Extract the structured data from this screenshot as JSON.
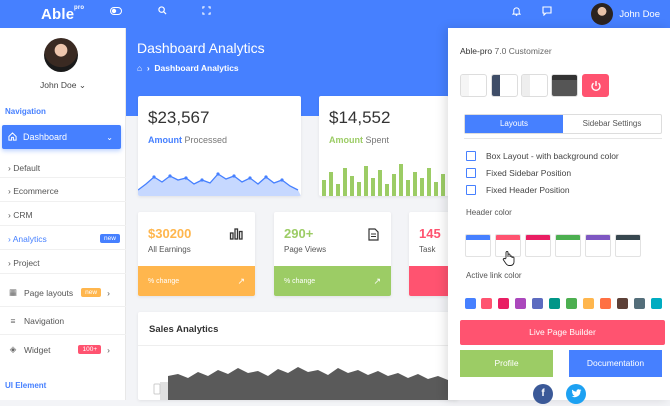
{
  "app": {
    "logo": "Able",
    "logo_sup": "pro"
  },
  "topbar": {
    "user_name": "John Doe"
  },
  "sidebar": {
    "user_name": "John Doe",
    "caption_navigation": "Navigation",
    "active_item": "Dashboard",
    "sub_items": [
      "Default",
      "Ecommerce",
      "CRM",
      "Analytics",
      "Project"
    ],
    "analytics_badge": "new",
    "page_layouts": "Page layouts",
    "page_layouts_badge": "new",
    "navigation": "Navigation",
    "widget": "Widget",
    "widget_badge": "100+",
    "caption_ui": "UI Element"
  },
  "header": {
    "title": "Dashboard Analytics",
    "breadcrumb": "Dashboard Analytics"
  },
  "cards": {
    "processed": {
      "value": "$23,567",
      "label_bold": "Amount",
      "label": "Processed",
      "color": "#4680ff"
    },
    "spent": {
      "value": "$14,552",
      "label_bold": "Amount",
      "label": "Spent",
      "color": "#9ccc65"
    }
  },
  "stats": [
    {
      "value": "$30200",
      "label": "All Earnings",
      "foot": "% change",
      "color": "#ffb64d",
      "icon": "bar-chart-icon"
    },
    {
      "value": "290+",
      "label": "Page Views",
      "foot": "% change",
      "color": "#9ccc65",
      "icon": "document-icon"
    },
    {
      "value": "145",
      "label": "Task",
      "foot": "",
      "color": "#ff5370",
      "icon": "task-icon"
    }
  ],
  "sales": {
    "title": "Sales Analytics"
  },
  "customizer": {
    "title": "Able-pro",
    "version": "7.0 Customizer",
    "tabs": [
      "Layouts",
      "Sidebar Settings"
    ],
    "options": [
      "Box Layout - with background color",
      "Fixed Sidebar Position",
      "Fixed Header Position"
    ],
    "header_color_label": "Header color",
    "header_colors": [
      "#4680ff",
      "#ff5370",
      "#e91e63",
      "#4caf50",
      "#7e57c2",
      "#37474f"
    ],
    "active_link_label": "Active link color",
    "link_colors": [
      "#4680ff",
      "#ff5370",
      "#e91e63",
      "#ab47bc",
      "#5c6bc0",
      "#009688",
      "#4caf50",
      "#ffb64d",
      "#ff7043",
      "#5d4037",
      "#546e7a",
      "#00acc1"
    ],
    "live_builder": "Live Page Builder",
    "profile": "Profile",
    "documentation": "Documentation"
  }
}
